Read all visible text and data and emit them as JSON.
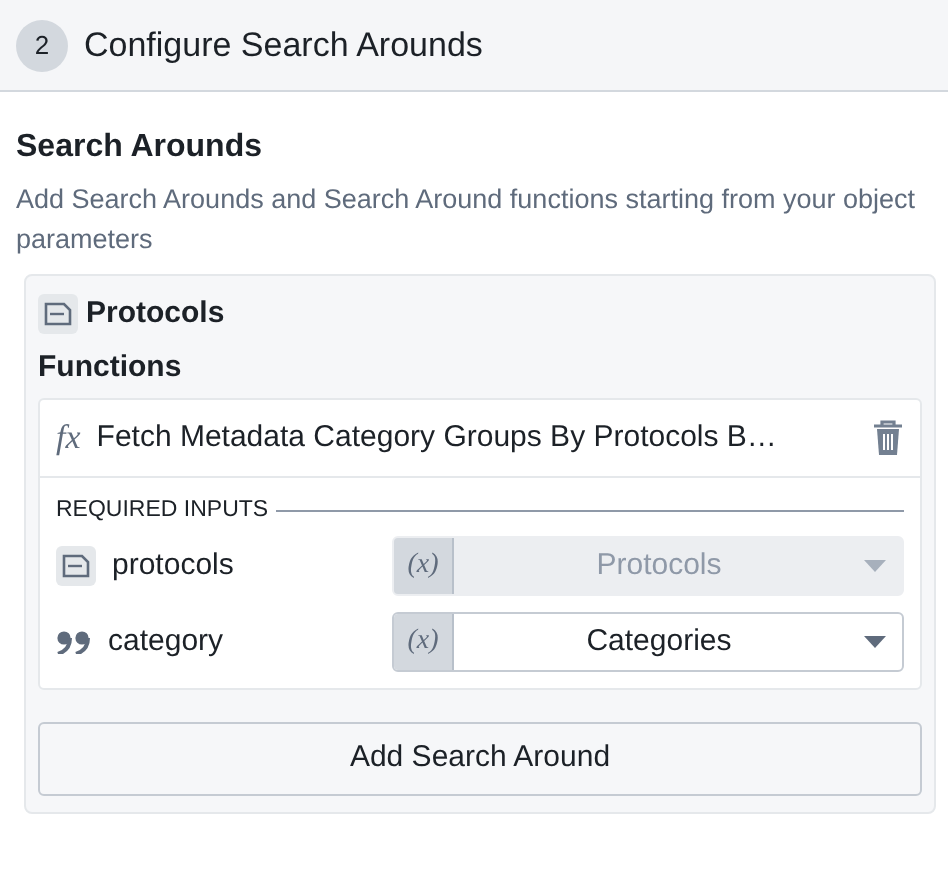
{
  "step": {
    "number": "2",
    "title": "Configure Search Arounds"
  },
  "section": {
    "title": "Search Arounds",
    "description": "Add Search Arounds and Search Around functions starting from your object parameters"
  },
  "object": {
    "name": "Protocols",
    "functions_label": "Functions",
    "function": {
      "symbol": "fx",
      "name": "Fetch Metadata Category Groups By Protocols B…",
      "inputs_label": "REQUIRED INPUTS",
      "inputs": [
        {
          "kind": "object",
          "name": "protocols",
          "variable_symbol": "(x)",
          "value": "Protocols",
          "disabled": true
        },
        {
          "kind": "string",
          "name": "category",
          "variable_symbol": "(x)",
          "value": "Categories",
          "disabled": false
        }
      ]
    }
  },
  "add_button": "Add Search Around"
}
